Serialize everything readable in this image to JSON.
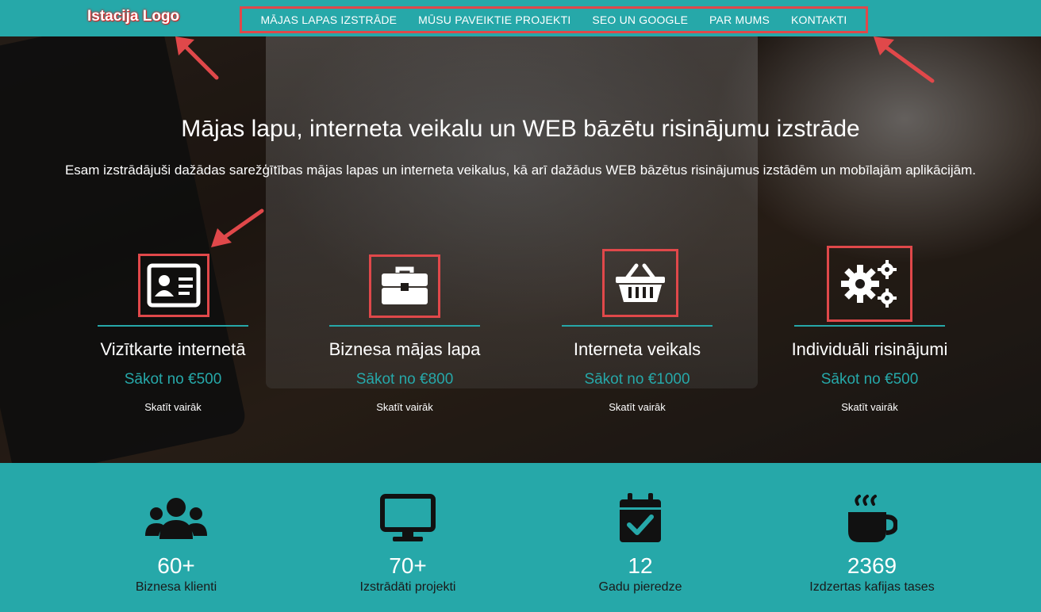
{
  "brand": {
    "logo_text": "Istacija Logo"
  },
  "nav": {
    "items": [
      {
        "label": "MĀJAS LAPAS IZSTRĀDE"
      },
      {
        "label": "MŪSU PAVEIKTIE PROJEKTI"
      },
      {
        "label": "SEO UN GOOGLE"
      },
      {
        "label": "PAR MUMS"
      },
      {
        "label": "KONTAKTI"
      }
    ]
  },
  "hero": {
    "title": "Mājas lapu, interneta veikalu un WEB bāzētu risinājumu izstrāde",
    "subtitle": "Esam izstrādājuši dažādas sarežģītības mājas lapas un interneta veikalus, kā arī dažādus WEB bāzētus risinājumus izstādēm un mobīlajām aplikācijām."
  },
  "services": [
    {
      "name": "Vizītkarte internetā",
      "price": "Sākot no €500",
      "more": "Skatīt vairāk",
      "icon": "id-card-icon"
    },
    {
      "name": "Biznesa mājas lapa",
      "price": "Sākot no €800",
      "more": "Skatīt vairāk",
      "icon": "briefcase-icon"
    },
    {
      "name": "Interneta veikals",
      "price": "Sākot no €1000",
      "more": "Skatīt vairāk",
      "icon": "basket-icon"
    },
    {
      "name": "Individuāli risinājumi",
      "price": "Sākot no €500",
      "more": "Skatīt vairāk",
      "icon": "gears-icon"
    }
  ],
  "stats": [
    {
      "value": "60+",
      "label": "Biznesa klienti",
      "icon": "users-icon"
    },
    {
      "value": "70+",
      "label": "Izstrādāti projekti",
      "icon": "desktop-icon"
    },
    {
      "value": "12",
      "label": "Gadu pieredze",
      "icon": "calendar-check-icon"
    },
    {
      "value": "2369",
      "label": "Izdzertas kafijas tases",
      "icon": "coffee-icon"
    }
  ],
  "colors": {
    "accent": "#26a8a9",
    "highlight": "#e0484a"
  }
}
